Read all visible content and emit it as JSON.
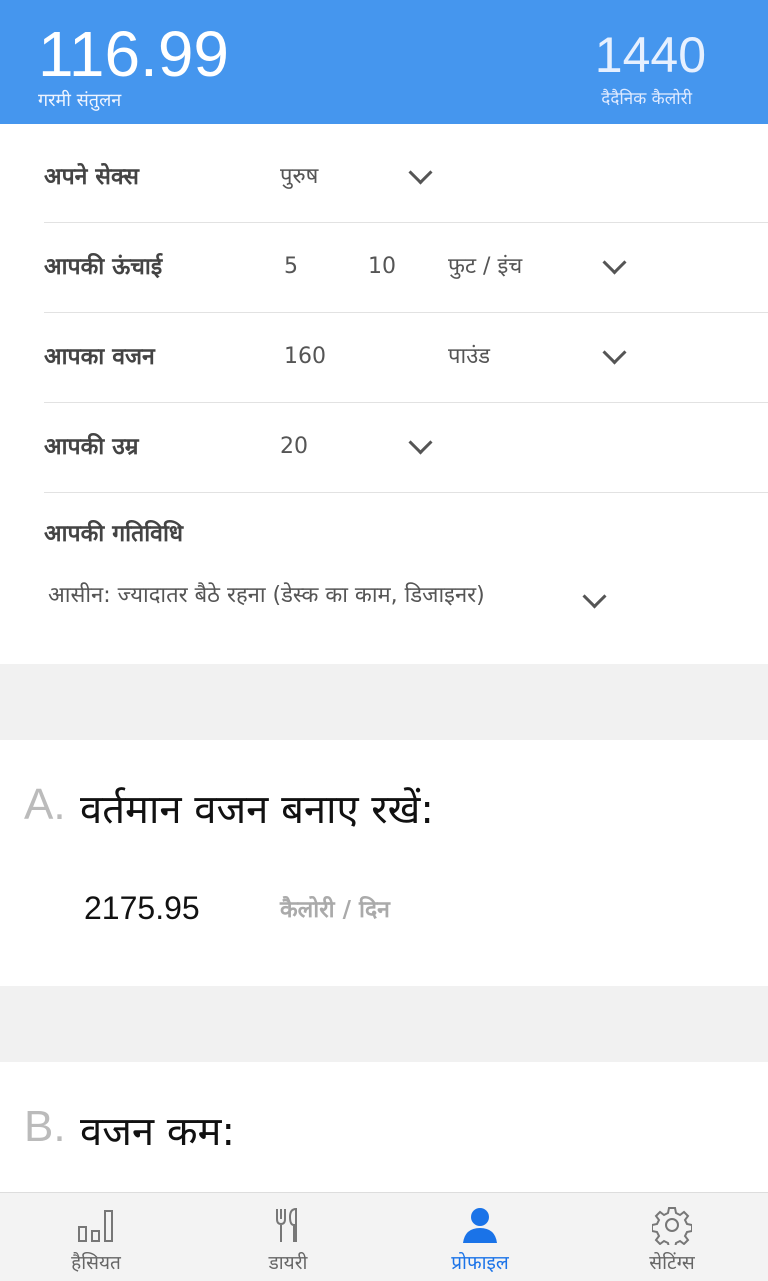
{
  "header": {
    "heat_balance_value": "116.99",
    "heat_balance_label": "गरमी संतुलन",
    "daily_calories_value": "1440",
    "daily_calories_label": "दैदैनिक कैलोरी",
    "color": "#4596ee"
  },
  "profile": {
    "sex": {
      "label": "अपने सेक्स",
      "value": "पुरुष"
    },
    "height": {
      "label": "आपकी ऊंचाई",
      "feet": "5",
      "inches": "10",
      "unit": "फुट / इंच"
    },
    "weight": {
      "label": "आपका वजन",
      "value": "160",
      "unit": "पाउंड"
    },
    "age": {
      "label": "आपकी उम्र",
      "value": "20"
    },
    "activity": {
      "label": "आपकी गतिविधि",
      "value": "आसीन: ज्यादातर बैठे रहना (डेस्क का काम, डिजाइनर)"
    }
  },
  "section_a": {
    "letter": "A.",
    "title": "वर्तमान वजन बनाए रखें:",
    "calories": "2175.95",
    "unit": "कैलोरी / दिन"
  },
  "section_b": {
    "letter": "B.",
    "title": "वजन कम:"
  },
  "tabs": [
    {
      "label": "हैसियत",
      "icon": "bar-chart-icon"
    },
    {
      "label": "डायरी",
      "icon": "fork-knife-icon"
    },
    {
      "label": "प्रोफाइल",
      "icon": "user-icon",
      "active": true
    },
    {
      "label": "सेटिंग्स",
      "icon": "gear-icon"
    }
  ],
  "active_tab_color": "#1a73e8"
}
